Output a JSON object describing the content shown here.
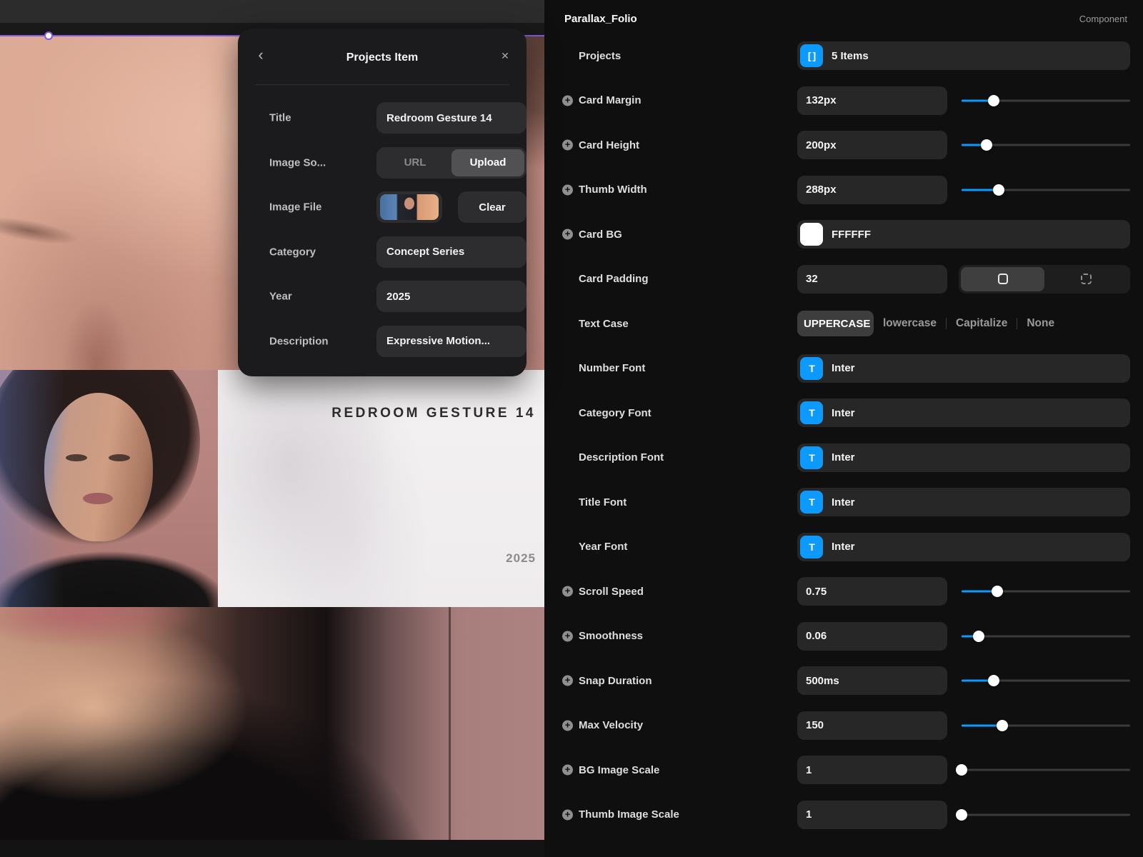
{
  "colors": {
    "accent_blue": "#0d9aff",
    "selection_purple": "#8257e6"
  },
  "canvas": {
    "project_card": {
      "title": "REDROOM GESTURE 14",
      "year": "2025"
    }
  },
  "dialog": {
    "back_icon": "‹",
    "close_icon": "✕",
    "title": "Projects Item",
    "rows": [
      {
        "type": "input",
        "label": "Title",
        "value": "Redroom Gesture 14"
      },
      {
        "type": "segmented",
        "label": "Image So...",
        "options": [
          "URL",
          "Upload"
        ],
        "selected": 1
      },
      {
        "type": "file",
        "label": "Image File",
        "thumb_icon": "image-thumbnail",
        "button": "Clear"
      },
      {
        "type": "input",
        "label": "Category",
        "value": "Concept Series"
      },
      {
        "type": "input",
        "label": "Year",
        "value": "2025"
      },
      {
        "type": "input",
        "label": "Description",
        "value": "Expressive Motion..."
      }
    ]
  },
  "panel": {
    "title": "Parallax_Folio",
    "badge": "Component",
    "rows": [
      {
        "type": "items",
        "label": "Projects",
        "value": "5 Items",
        "icon_glyph": "[ ]"
      },
      {
        "type": "slider",
        "label": "Card Margin",
        "value": "132px",
        "slider_pos": 0.19,
        "has_plus": true
      },
      {
        "type": "slider",
        "label": "Card Height",
        "value": "200px",
        "slider_pos": 0.15,
        "has_plus": true
      },
      {
        "type": "slider",
        "label": "Thumb Width",
        "value": "288px",
        "slider_pos": 0.22,
        "has_plus": true
      },
      {
        "type": "color",
        "label": "Card BG",
        "value": "FFFFFF",
        "swatch": "#ffffff",
        "has_plus": true
      },
      {
        "type": "padding",
        "label": "Card Padding",
        "value": "32"
      },
      {
        "type": "textcase",
        "label": "Text Case",
        "options": [
          "UPPERCASE",
          "lowercase",
          "Capitalize",
          "None"
        ],
        "selected": 0
      },
      {
        "type": "font",
        "label": "Number Font",
        "value": "Inter",
        "icon_glyph": "T"
      },
      {
        "type": "font",
        "label": "Category Font",
        "value": "Inter",
        "icon_glyph": "T"
      },
      {
        "type": "font",
        "label": "Description Font",
        "value": "Inter",
        "icon_glyph": "T"
      },
      {
        "type": "font",
        "label": "Title Font",
        "value": "Inter",
        "icon_glyph": "T"
      },
      {
        "type": "font",
        "label": "Year Font",
        "value": "Inter",
        "icon_glyph": "T"
      },
      {
        "type": "slider",
        "label": "Scroll Speed",
        "value": "0.75",
        "slider_pos": 0.21,
        "has_plus": true
      },
      {
        "type": "slider",
        "label": "Smoothness",
        "value": "0.06",
        "slider_pos": 0.1,
        "has_plus": true
      },
      {
        "type": "slider",
        "label": "Snap Duration",
        "value": "500ms",
        "slider_pos": 0.19,
        "has_plus": true
      },
      {
        "type": "slider",
        "label": "Max Velocity",
        "value": "150",
        "slider_pos": 0.24,
        "has_plus": true
      },
      {
        "type": "slider",
        "label": "BG Image Scale",
        "value": "1",
        "slider_pos": 0.0,
        "has_plus": true
      },
      {
        "type": "slider",
        "label": "Thumb Image Scale",
        "value": "1",
        "slider_pos": 0.0,
        "has_plus": true
      }
    ]
  }
}
